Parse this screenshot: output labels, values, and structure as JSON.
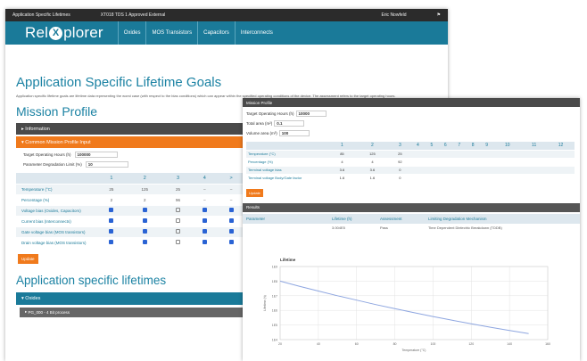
{
  "topbar": {
    "title": "Application Specific Lifetimes",
    "release": "XT018 TDS 1 Approved External",
    "user": "Eric Nowfeld"
  },
  "brand": {
    "pre": "Rel",
    "x": "X",
    "post": "plorer"
  },
  "nav": [
    "Oxides",
    "MOS Transistors",
    "Capacitors",
    "Interconnects"
  ],
  "page": {
    "title": "Application Specific Lifetime Goals",
    "description": "Application specific lifetime goals are lifetime data representing the worst case (with respect to the bias conditions) which can appear within the specified operating conditions of the device. The assessment refers to the target operating hours.",
    "mission_profile": "Mission Profile",
    "information": "Information",
    "common_input": "Common Mission Profile Input",
    "lifetimes_title": "Application specific lifetimes",
    "oxides": "Oxides",
    "sub_item": "PG_000 - 4 Bit process"
  },
  "mp": {
    "hours_label": "Target Operating Hours (h)",
    "hours_value": "100000",
    "param_label": "Parameter Degradation Limit (%)",
    "param_value": "10",
    "columns": [
      "1",
      "2",
      "3",
      "4",
      ">"
    ],
    "rows": [
      {
        "label": "Temperature (°C)",
        "cells": [
          "25",
          "125",
          "25",
          "–",
          "–"
        ]
      },
      {
        "label": "Percentage (%)",
        "cells": [
          "2",
          "2",
          "96",
          "–",
          "–"
        ]
      },
      {
        "label": "Voltage bias (Oxides, Capacitors)",
        "cells": [
          "x",
          "x",
          "o",
          "x",
          "x"
        ]
      },
      {
        "label": "Current bias (Interconnects)",
        "cells": [
          "x",
          "x",
          "o",
          "x",
          "x"
        ]
      },
      {
        "label": "Gate voltage bias (MOS transistors)",
        "cells": [
          "x",
          "x",
          "o",
          "x",
          "x"
        ]
      },
      {
        "label": "Drain voltage bias (MOS transistors)",
        "cells": [
          "x",
          "x",
          "o",
          "x",
          "x"
        ]
      }
    ],
    "update": "Update"
  },
  "win2": {
    "header": "Mission Profile",
    "hours_label": "Target Operating Hours (h)",
    "hours_value": "10000",
    "area_label": "Total area (m²)",
    "area_value": "0.1",
    "volume_label": "Volume area (m³)",
    "volume_value": "100",
    "columns": [
      "1",
      "2",
      "3",
      "4",
      "5",
      "6",
      "7",
      "8",
      "9",
      "10",
      "11",
      "12"
    ],
    "rows": [
      {
        "label": "Temperature (°C)",
        "cells": [
          "85",
          "125",
          "25",
          "",
          "",
          "",
          "",
          "",
          "",
          "",
          "",
          ""
        ]
      },
      {
        "label": "Percentage (%)",
        "cells": [
          "4",
          "4",
          "92",
          "",
          "",
          "",
          "",
          "",
          "",
          "",
          "",
          ""
        ]
      },
      {
        "label": "Terminal voltage bias",
        "cells": [
          "3.6",
          "3.6",
          "0",
          "",
          "",
          "",
          "",
          "",
          "",
          "",
          "",
          ""
        ]
      },
      {
        "label": "Terminal voltage Body/Gate factor",
        "cells": [
          "1.6",
          "1.6",
          "0",
          "",
          "",
          "",
          "",
          "",
          "",
          "",
          "",
          ""
        ]
      }
    ],
    "update": "Update",
    "results_header": "Results",
    "res_cols": [
      "Parameter",
      "Lifetime (h)",
      "Assessment",
      "Limiting Degradation Mechanism"
    ],
    "res_row": [
      "",
      "3.004E5",
      "Pass",
      "Time Dependent Dielectric Breakdown (TDDB)"
    ]
  },
  "chart_data": {
    "type": "line",
    "title": "Lifetime",
    "xlabel": "Temperature (°C)",
    "ylabel": "Lifetime (h)",
    "yscale": "log",
    "x": [
      20,
      30,
      40,
      50,
      60,
      70,
      80,
      90,
      100,
      110,
      120,
      130,
      140,
      150
    ],
    "y": [
      100000000,
      45000000,
      21000000,
      10000000,
      5000000,
      2500000,
      1300000,
      700000,
      380000,
      210000,
      120000,
      70000,
      42000,
      26000
    ],
    "yticks": [
      "1E9",
      "1E8",
      "1E7",
      "1E6",
      "1E5",
      "1E4"
    ],
    "xticks": [
      "20",
      "40",
      "60",
      "80",
      "100",
      "120",
      "140",
      "160"
    ],
    "line_color": "#8ea6e0",
    "grid": true
  }
}
